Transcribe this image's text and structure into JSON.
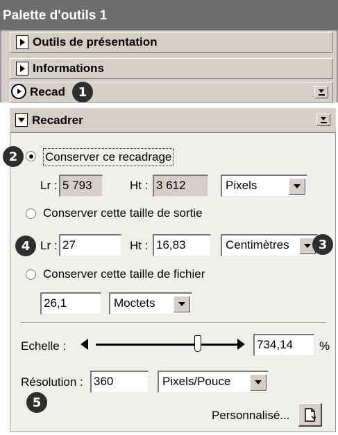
{
  "palette": {
    "title": "Palette d'outils 1",
    "sections": [
      {
        "label": "Outils de présentation"
      },
      {
        "label": "Informations"
      },
      {
        "label": "Recad"
      }
    ]
  },
  "crop": {
    "title": "Recadrer",
    "keep_crop_label": "Conserver ce recadrage",
    "keep_crop": {
      "w_label": "Lr :",
      "w_value": "5 793",
      "h_label": "Ht :",
      "h_value": "3 612",
      "unit": "Pixels"
    },
    "output_size_label": "Conserver cette taille de sortie",
    "output_size": {
      "w_label": "Lr :",
      "w_value": "27",
      "h_label": "Ht :",
      "h_value": "16,83",
      "unit": "Centimètres"
    },
    "file_size_label": "Conserver cette taille de fichier",
    "file_size": {
      "value": "26,1",
      "unit": "Moctets"
    },
    "scale_label": "Echelle :",
    "scale_value": "734,14",
    "scale_unit": "%",
    "scale_slider_fraction": 0.72,
    "resolution_label": "Résolution :",
    "resolution_value": "360",
    "resolution_unit": "Pixels/Pouce",
    "custom_label": "Personnalisé..."
  },
  "badges": [
    "1",
    "2",
    "3",
    "4",
    "5"
  ],
  "icons": {
    "expand": "triangle-right-icon",
    "collapse": "triangle-down-icon",
    "dropdown": "chevron-down-icon",
    "custom": "document-icon"
  }
}
